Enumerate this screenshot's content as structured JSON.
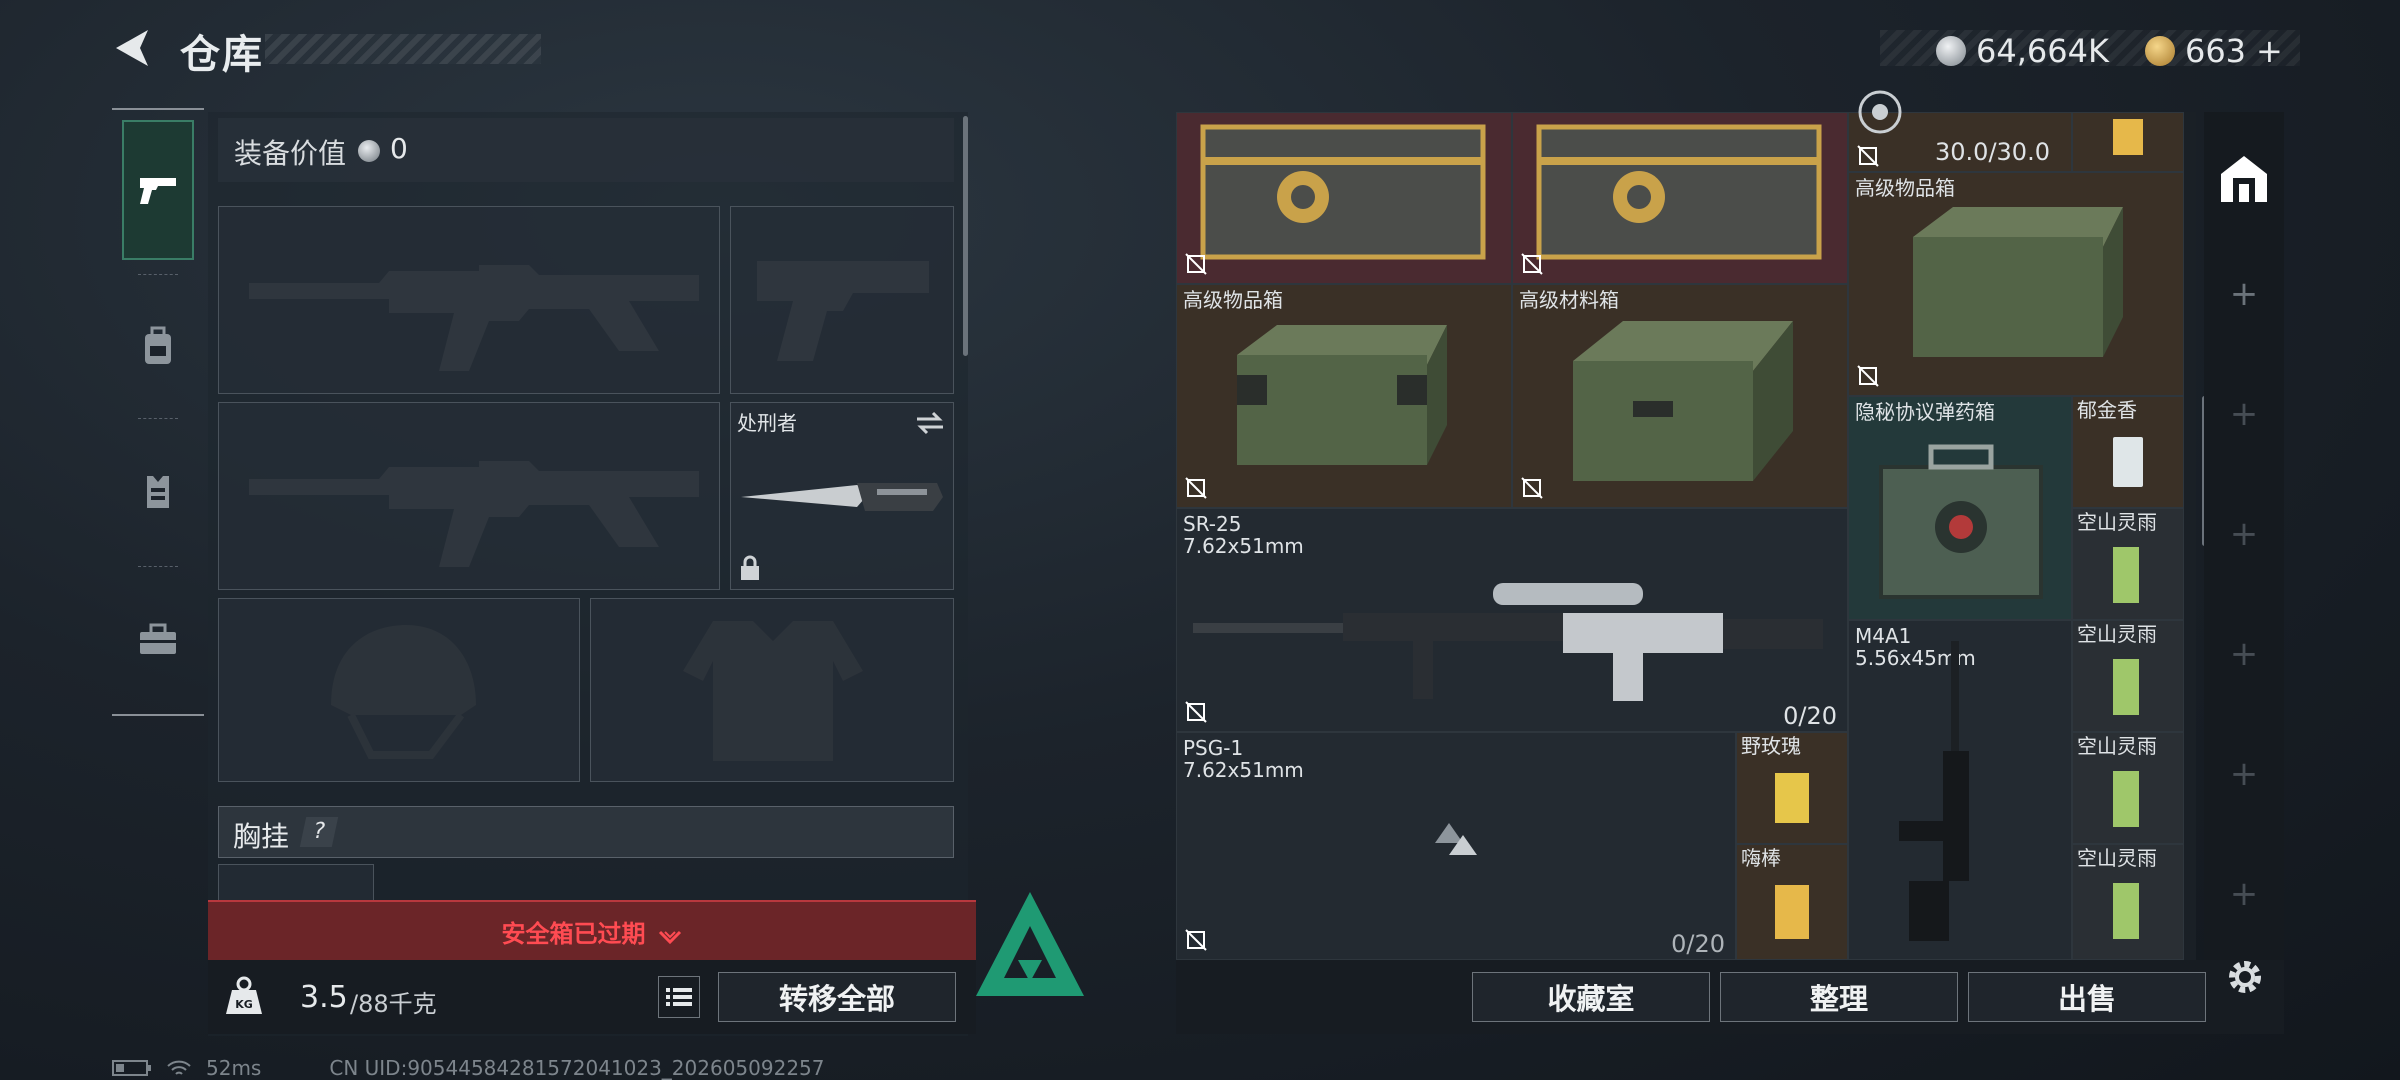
{
  "header": {
    "title": "仓库",
    "currency_1": "64,664K",
    "currency_2": "663",
    "currency_2_plus": "+"
  },
  "tabs": [
    {
      "icon": "pistol-icon",
      "active": true
    },
    {
      "icon": "backpack-icon",
      "active": false
    },
    {
      "icon": "vest-icon",
      "active": false
    },
    {
      "icon": "toolbox-icon",
      "active": false
    }
  ],
  "equipment": {
    "value_label": "装备价值",
    "value": "0",
    "melee_name": "处刑者",
    "chest_label": "胸挂",
    "chest_help": "?"
  },
  "safe_box": {
    "expired_text": "安全箱已过期"
  },
  "weight": {
    "current": "3.5",
    "max": "/88千克",
    "transfer_all": "转移全部"
  },
  "stash": {
    "items": [
      {
        "name": "高级物品箱"
      },
      {
        "name": "高级材料箱"
      },
      {
        "name": "高级物品箱"
      },
      {
        "name": "隐秘协议弹药箱"
      },
      {
        "name": "郁金香"
      },
      {
        "name": "空山灵雨"
      },
      {
        "name": "空山灵雨"
      },
      {
        "name": "空山灵雨"
      },
      {
        "name": "空山灵雨"
      },
      {
        "name": "野玫瑰"
      },
      {
        "name": "嗨棒"
      },
      {
        "name": "SR-25",
        "caliber": "7.62x51mm",
        "ammo": "0/20"
      },
      {
        "name": "PSG-1",
        "caliber": "7.62x51mm",
        "ammo": "0/20"
      },
      {
        "name": "M4A1",
        "caliber": "5.56x45mm"
      }
    ],
    "durability": "30.0/30.0"
  },
  "actions": {
    "collection": "收藏室",
    "sort": "整理",
    "sell": "出售"
  },
  "status_bar": {
    "ping": "52ms",
    "uid": "CN UID:90544584281572041023_202605092257"
  },
  "colors": {
    "accent_green": "#3fb88c",
    "alert_red": "#e0454a",
    "locked_cell": "#4a2a30",
    "container_cell": "#3a3026"
  }
}
